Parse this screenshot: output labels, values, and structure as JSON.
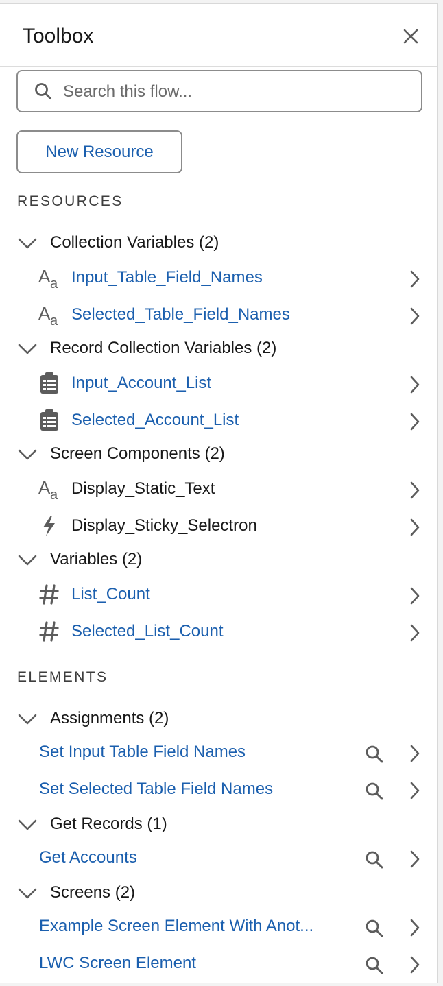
{
  "header": {
    "title": "Toolbox"
  },
  "search": {
    "placeholder": "Search this flow..."
  },
  "new_resource_label": "New Resource",
  "resources": {
    "heading": "RESOURCES",
    "groups": [
      {
        "label": "Collection Variables (2)",
        "items": [
          {
            "label": "Input_Table_Field_Names",
            "icon": "text-icon"
          },
          {
            "label": "Selected_Table_Field_Names",
            "icon": "text-icon"
          }
        ]
      },
      {
        "label": "Record Collection Variables (2)",
        "items": [
          {
            "label": "Input_Account_List",
            "icon": "record-list-icon"
          },
          {
            "label": "Selected_Account_List",
            "icon": "record-list-icon"
          }
        ]
      },
      {
        "label": "Screen Components (2)",
        "items": [
          {
            "label": "Display_Static_Text",
            "icon": "text-icon"
          },
          {
            "label": "Display_Sticky_Selectron",
            "icon": "lightning-icon"
          }
        ]
      },
      {
        "label": "Variables (2)",
        "items": [
          {
            "label": "List_Count",
            "icon": "number-icon"
          },
          {
            "label": "Selected_List_Count",
            "icon": "number-icon"
          }
        ]
      }
    ]
  },
  "elements": {
    "heading": "ELEMENTS",
    "groups": [
      {
        "label": "Assignments (2)",
        "items": [
          {
            "label": "Set Input Table Field Names"
          },
          {
            "label": "Set Selected Table Field Names"
          }
        ]
      },
      {
        "label": "Get Records (1)",
        "items": [
          {
            "label": "Get Accounts"
          }
        ]
      },
      {
        "label": "Screens (2)",
        "items": [
          {
            "label": "Example Screen Element With Anot..."
          },
          {
            "label": "LWC Screen Element"
          }
        ]
      }
    ]
  },
  "colors": {
    "link": "#1b5fae",
    "text": "#181818",
    "border": "#8c8c8c"
  }
}
